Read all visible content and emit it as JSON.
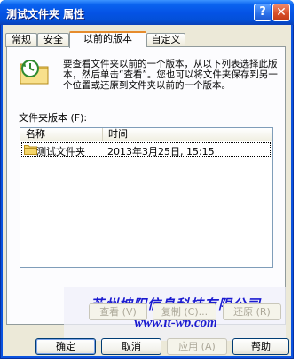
{
  "window": {
    "title": "测试文件夹 属性",
    "help_glyph": "?",
    "close_glyph": "✕"
  },
  "tabs": [
    {
      "label": "常规"
    },
    {
      "label": "安全"
    },
    {
      "label": "以前的版本"
    },
    {
      "label": "自定义"
    }
  ],
  "active_tab": "以前的版本",
  "panel": {
    "description": "要查看文件夹以前的一个版本，从以下列表选择此版本，然后单击“查看”。您也可以将文件夹保存到另一个位置或还原到文件夹以前的一个版本。",
    "list_label": "文件夹版本 (F):",
    "columns": {
      "name": "名称",
      "time": "时间"
    },
    "rows": [
      {
        "name": "测试文件夹",
        "time": "2013年3月25日, 15:15"
      }
    ],
    "buttons": {
      "view": "查看 (V)",
      "copy": "复制 (C)...",
      "restore": "还原 (R)"
    }
  },
  "watermark": {
    "company": "苏州坤阳信息科技有限公司",
    "url": "www.it-wb.com"
  },
  "footer": {
    "ok": "确定",
    "cancel": "取消",
    "apply": "应用 (A)",
    "help": "帮助"
  },
  "colors": {
    "titlebar": "#0553E6",
    "dialog_bg": "#ECE9D8",
    "panel_bg": "#FCFCFE",
    "active_tab_accent": "#E68B2C",
    "watermark_text": "#1A1AD0"
  },
  "icons": {
    "dialog": "folder-clock-icon",
    "row": "folder-icon"
  }
}
